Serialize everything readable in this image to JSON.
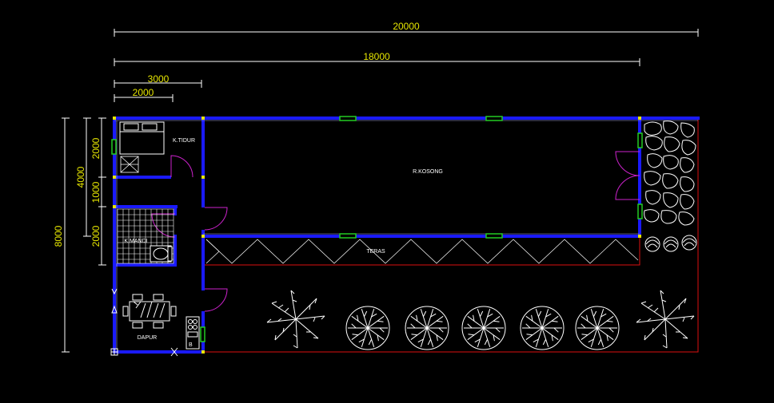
{
  "colors": {
    "background": "#000000",
    "wall": "#1a1aff",
    "dimension": "#e6e600",
    "dimension_line": "#ffffff",
    "window": "#22cc22",
    "door": "#cc22cc",
    "boundary": "#dd1111",
    "text": "#ffffff",
    "node": "#e6e600"
  },
  "dimensions": {
    "total_length": "20000",
    "building_length": "18000",
    "left_width": "3000",
    "bedroom_width": "2000",
    "total_depth": "8000",
    "left_depth": "4000",
    "bedroom_depth": "2000",
    "corridor_depth": "1000",
    "bathroom_depth": "2000"
  },
  "rooms": {
    "bedroom": "K.TIDUR",
    "empty_room": "R.KOSONG",
    "bathroom": "K.MANDI",
    "terrace": "TERAS",
    "kitchen": "DAPUR"
  },
  "icons": {
    "bed": "bed-icon",
    "table": "dining-table-icon",
    "stove": "stove-icon",
    "toilet": "toilet-icon",
    "palm": "palm-tree-icon",
    "tree": "round-tree-icon",
    "shrub": "shrub-icon",
    "stone": "stone-paving-icon"
  }
}
